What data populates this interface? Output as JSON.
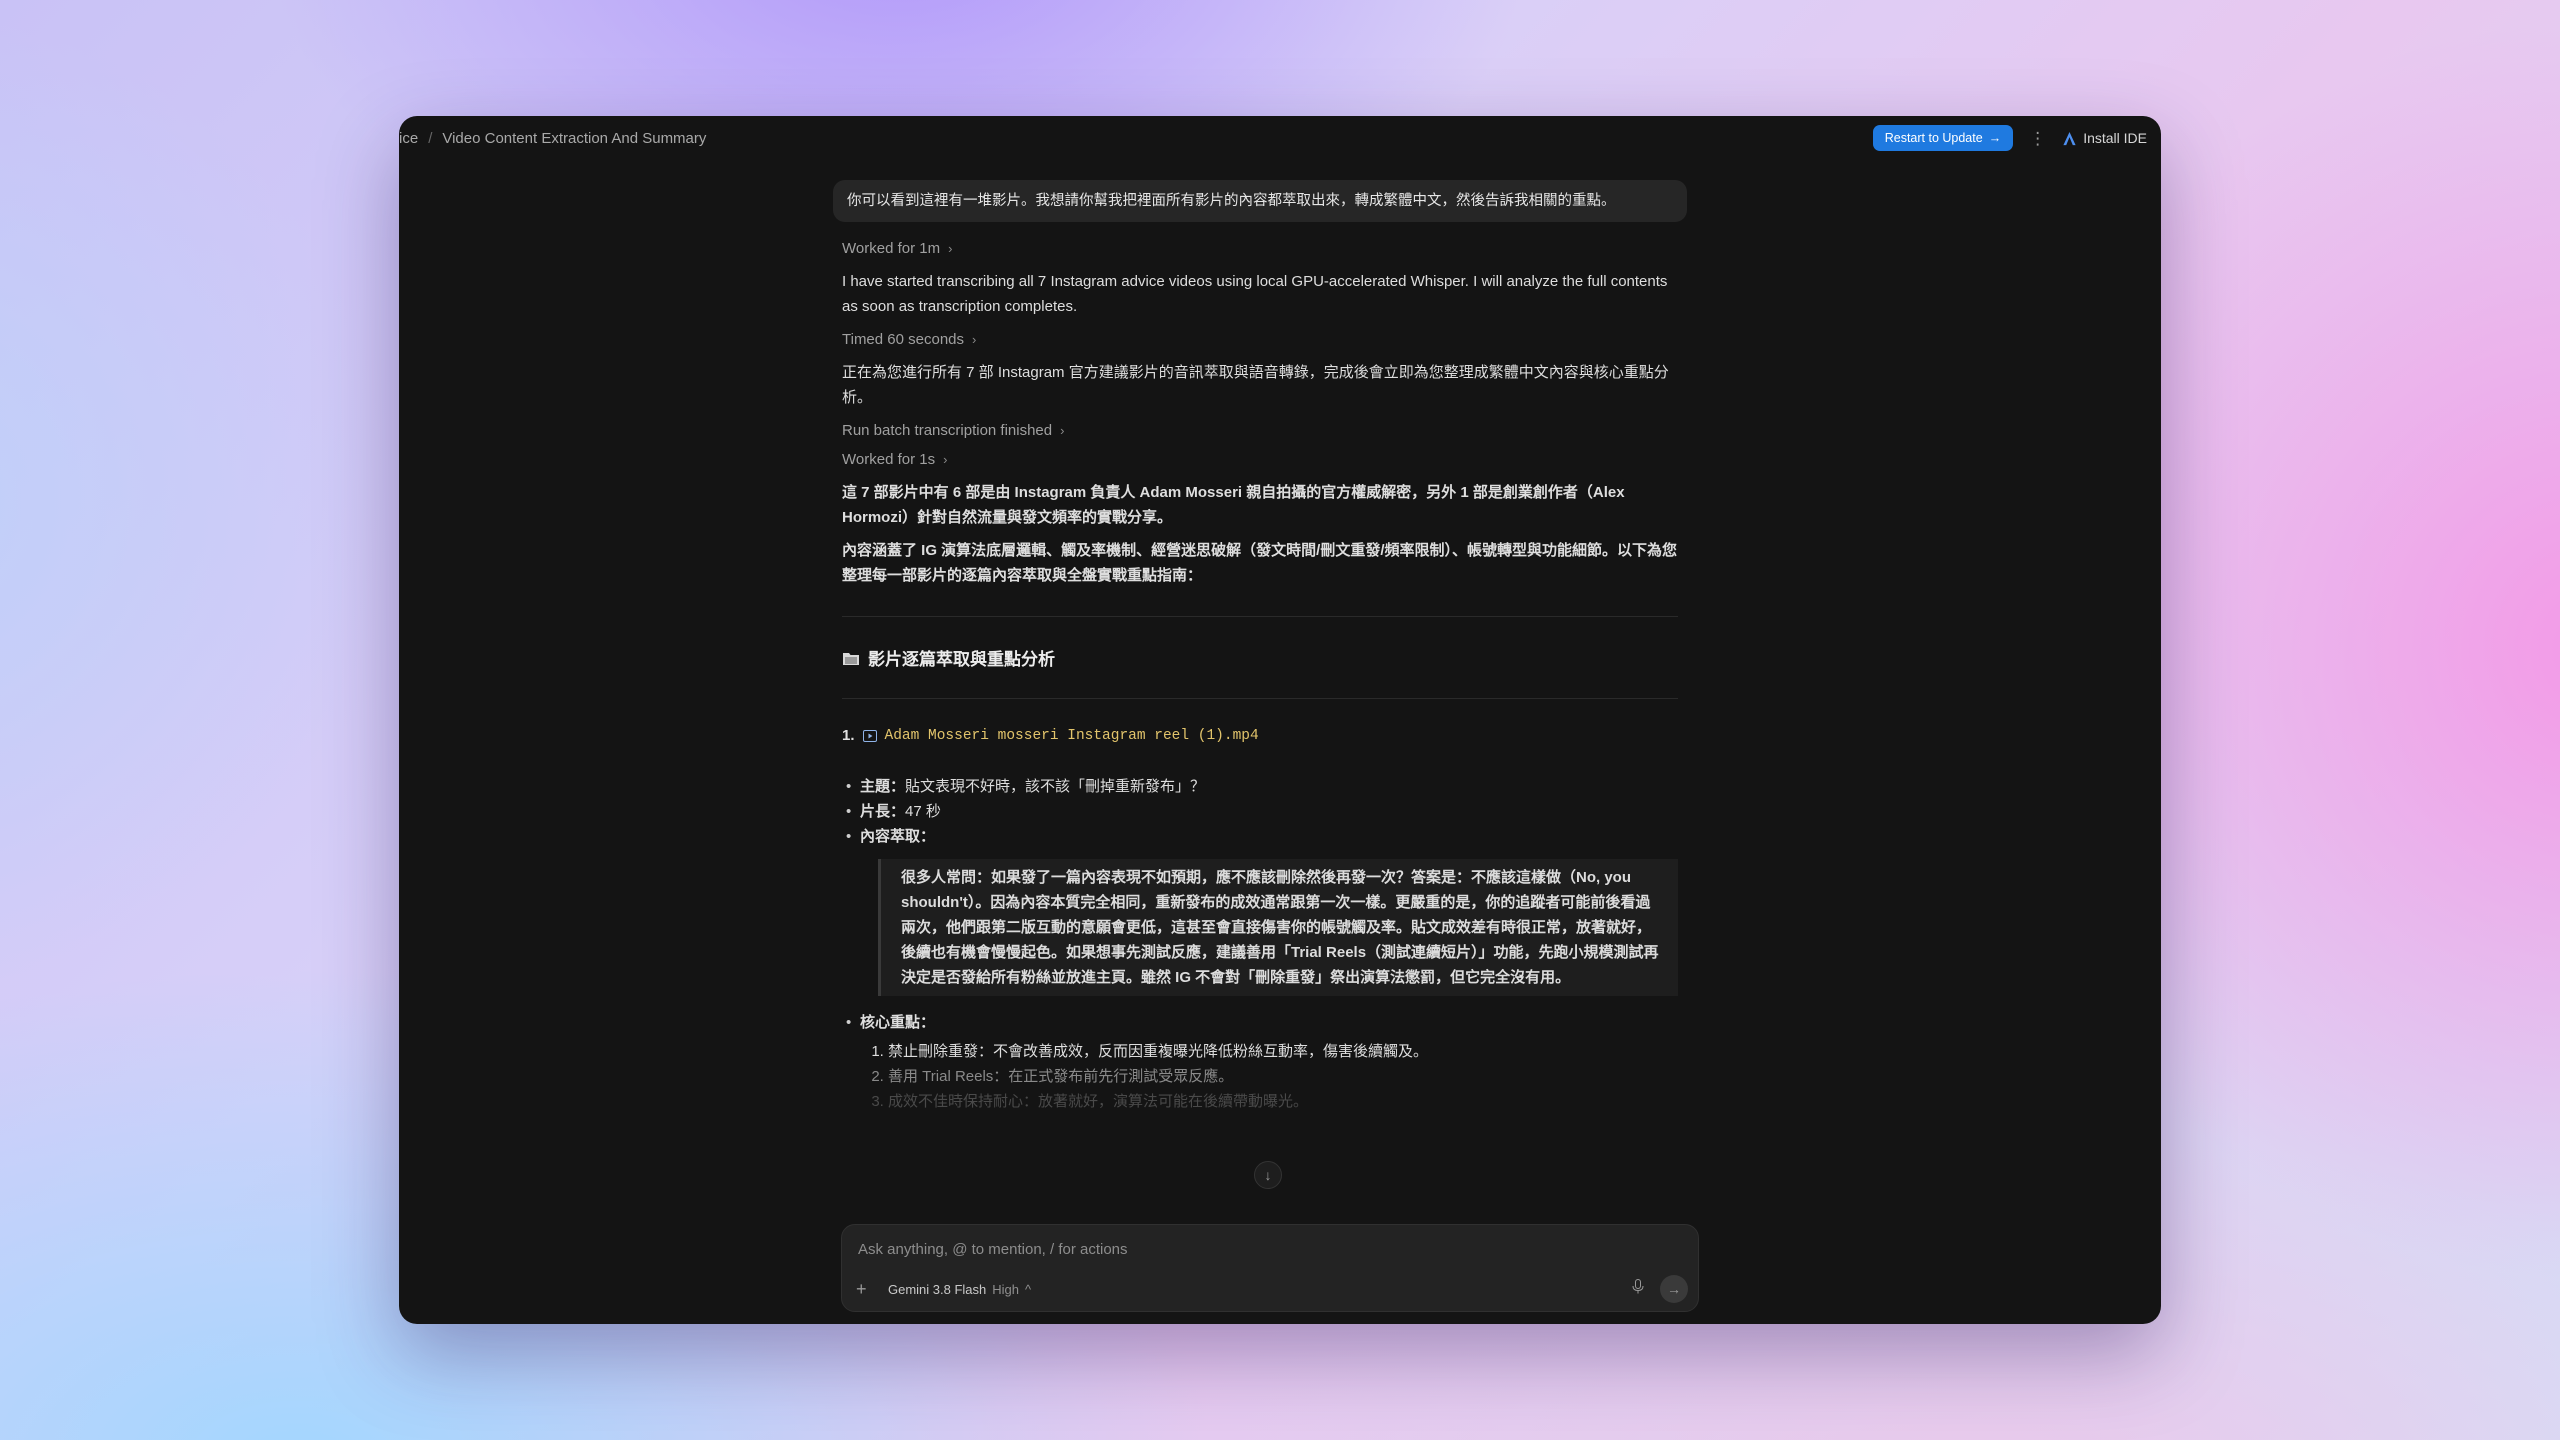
{
  "breadcrumb": {
    "prev": "ice",
    "separator": "/",
    "current": "Video Content Extraction And Summary"
  },
  "topbar": {
    "restart_label": "Restart to Update",
    "restart_arrow": "→",
    "more": "⋮",
    "install_label": "Install IDE"
  },
  "colors": {
    "accent": "#1f7ae0",
    "filename": "#e2c46b",
    "window_bg": "#141414"
  },
  "conversation": {
    "user_message": "你可以看到這裡有一堆影片。我想請你幫我把裡面所有影片的內容都萃取出來，轉成繁體中文，然後告訴我相關的重點。",
    "step1": "Worked for 1m",
    "msg1": "I have started transcribing all 7 Instagram advice videos using local GPU-accelerated Whisper. I will analyze the full contents as soon as transcription completes.",
    "step2": "Timed 60 seconds",
    "msg2": "正在為您進行所有 7 部 Instagram 官方建議影片的音訊萃取與語音轉錄，完成後會立即為您整理成繁體中文內容與核心重點分析。",
    "step3": "Run batch transcription finished",
    "step4": "Worked for 1s",
    "msg3": "這 7 部影片中有 6 部是由 Instagram 負責人 Adam Mosseri 親自拍攝的官方權威解密，另外 1 部是創業創作者（Alex Hormozi）針對自然流量與發文頻率的實戰分享。",
    "msg4": "內容涵蓋了 IG 演算法底層邏輯、觸及率機制、經營迷思破解（發文時間/刪文重發/頻率限制）、帳號轉型與功能細節。以下為您整理每一部影片的逐篇內容萃取與全盤實戰重點指南：",
    "section_title": "影片逐篇萃取與重點分析",
    "video1": {
      "index": "1.",
      "filename": "Adam Mosseri mosseri Instagram reel (1).mp4",
      "topic_label": "主題：",
      "topic": "貼文表現不好時，該不該「刪掉重新發布」？",
      "length_label": "片長：",
      "length": "47 秒",
      "extract_label": "內容萃取：",
      "quote": "很多人常問：如果發了一篇內容表現不如預期，應不應該刪除然後再發一次？答案是：不應該這樣做（No, you shouldn't）。因為內容本質完全相同，重新發布的成效通常跟第一次一樣。更嚴重的是，你的追蹤者可能前後看過兩次，他們跟第二版互動的意願會更低，這甚至會直接傷害你的帳號觸及率。貼文成效差有時很正常，放著就好，後續也有機會慢慢起色。如果想事先測試反應，建議善用「Trial Reels（測試連續短片）」功能，先跑小規模測試再決定是否發給所有粉絲並放進主頁。雖然 IG 不會對「刪除重發」祭出演算法懲罰，但它完全沒有用。",
      "key_label": "核心重點：",
      "points": [
        "禁止刪除重發：不會改善成效，反而因重複曝光降低粉絲互動率，傷害後續觸及。",
        "善用 Trial Reels：在正式發布前先行測試受眾反應。",
        "成效不佳時保持耐心：放著就好，演算法可能在後續帶動曝光。"
      ]
    }
  },
  "composer": {
    "placeholder": "Ask anything, @ to mention, / for actions",
    "plus": "+",
    "model": "Gemini 3.8 Flash",
    "level": "High",
    "caret": "^"
  }
}
